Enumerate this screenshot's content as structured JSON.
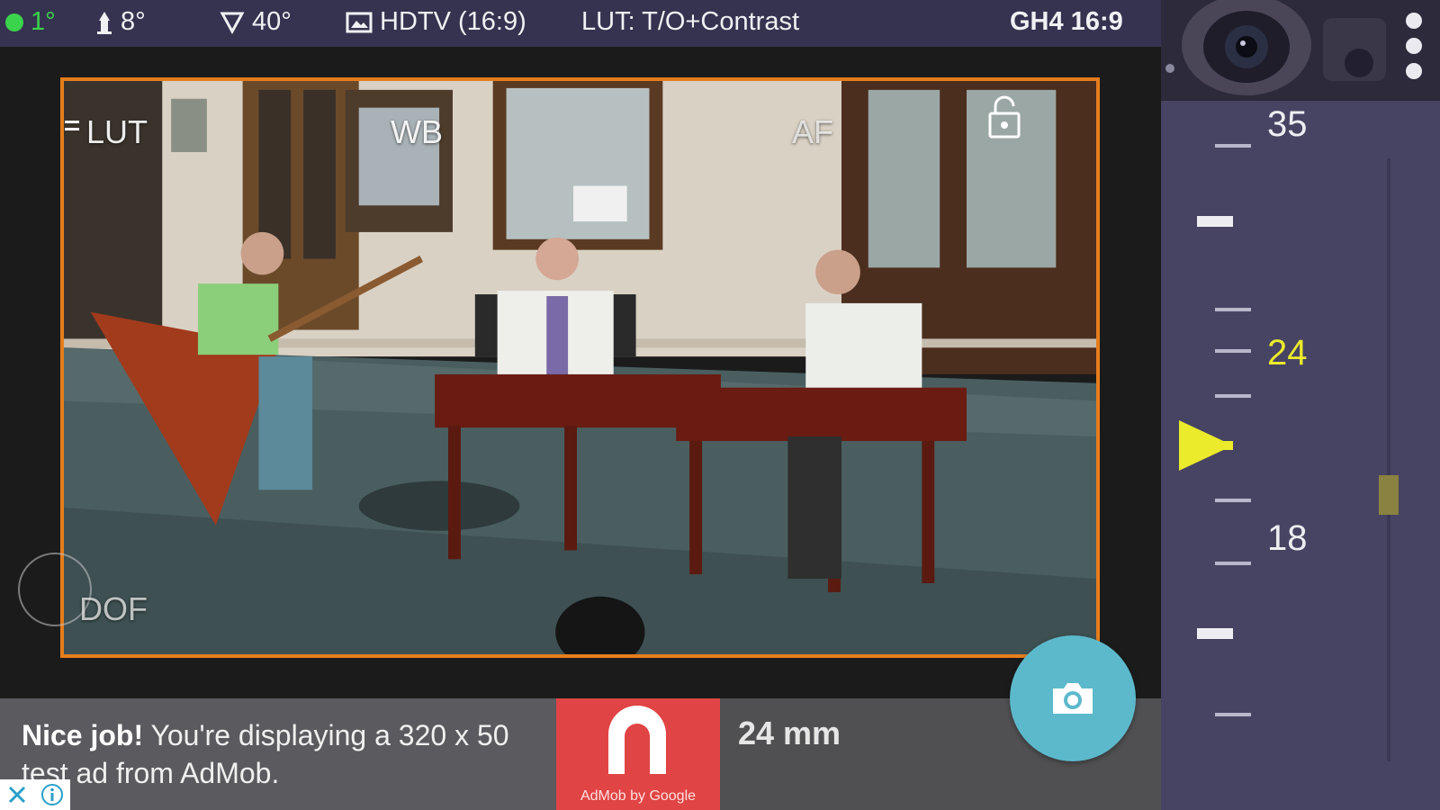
{
  "status_bar": {
    "level": "1°",
    "tilt": "8°",
    "fov": "40°",
    "format": "HDTV (16:9)",
    "lut": "LUT: T/O+Contrast",
    "camera": "GH4 16:9",
    "level_color": "#3bd34b"
  },
  "viewfinder": {
    "lut_label": "LUT",
    "wb_label": "WB",
    "af_label": "AF",
    "dof_label": "DOF",
    "frame_color": "#e67d1c"
  },
  "ad": {
    "headline": "Nice job!",
    "body": "You're displaying a 320 x 50 test ad from AdMob.",
    "logo_caption": "AdMob by Google"
  },
  "focal_length": "24 mm",
  "zoom_scale": {
    "labels": [
      "35",
      "24",
      "18"
    ],
    "selected": "24",
    "selected_color": "#ebea2b"
  },
  "icons": {
    "level": "level-dot",
    "tilt": "tilt-icon",
    "fov": "fov-icon",
    "format": "frame-icon",
    "lock": "unlock-icon",
    "shutter": "camera-icon",
    "menu": "overflow-menu-icon"
  }
}
